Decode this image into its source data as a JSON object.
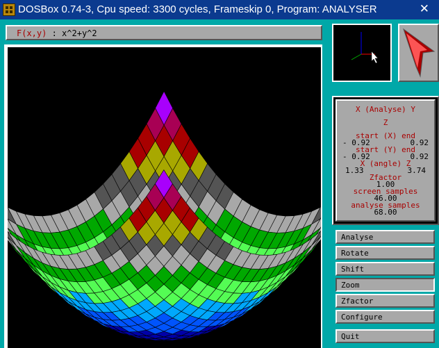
{
  "window": {
    "title": "DOSBox 0.74-3, Cpu speed: 3300 cycles, Frameskip 0, Program: ANALYSER",
    "close_glyph": "✕"
  },
  "formula": {
    "label": "F(x,y)",
    "separator": " : ",
    "expression": "x^2+y^2"
  },
  "info": {
    "heading": "X (Analyse) Y",
    "axis": "Z",
    "x_range_label": "start (X) end",
    "x_range_sign": "-",
    "x_start": "0.92",
    "x_end": "0.92",
    "y_range_label": "start (Y) end",
    "y_range_sign": "-",
    "y_start": "0.92",
    "y_end": "0.92",
    "angle_label": "X (angle) Z",
    "angle_x": "1.33",
    "angle_z": "3.74",
    "zfactor_label": "Zfactor",
    "zfactor_value": "1.00",
    "screen_samples_label": "screen samples",
    "screen_samples_value": "46.00",
    "analyse_samples_label": "analyse samples",
    "analyse_samples_value": "68.00"
  },
  "menu": [
    {
      "label": "Analyse",
      "pressed": false
    },
    {
      "label": "Rotate",
      "pressed": false
    },
    {
      "label": "Shift",
      "pressed": false
    },
    {
      "label": "Zoom",
      "pressed": true
    },
    {
      "label": "Zfactor",
      "pressed": false
    },
    {
      "label": "Configure",
      "pressed": false
    },
    {
      "label": "Quit",
      "pressed": false
    }
  ],
  "surface": {
    "band_colors": [
      "#0000a8",
      "#0054fc",
      "#00a8fc",
      "#54fc54",
      "#00a800",
      "#a8a8a8",
      "#545454",
      "#a8a800",
      "#a80000",
      "#a80054",
      "#a800fc"
    ]
  }
}
